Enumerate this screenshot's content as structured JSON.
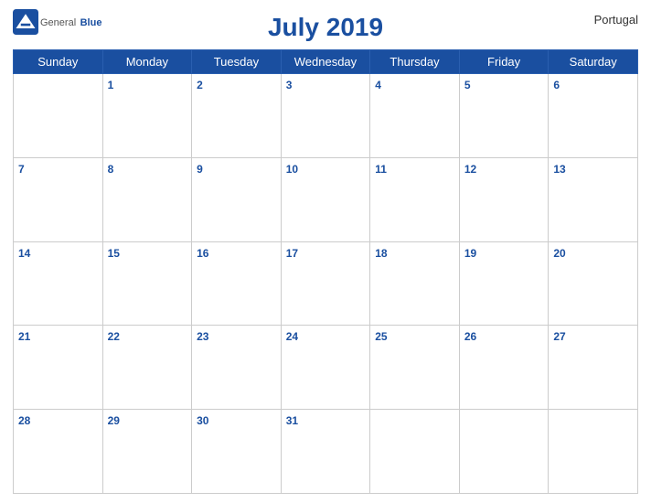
{
  "header": {
    "title": "July 2019",
    "country": "Portugal",
    "logo": {
      "general": "General",
      "blue": "Blue"
    }
  },
  "days_of_week": [
    "Sunday",
    "Monday",
    "Tuesday",
    "Wednesday",
    "Thursday",
    "Friday",
    "Saturday"
  ],
  "weeks": [
    [
      null,
      1,
      2,
      3,
      4,
      5,
      6
    ],
    [
      7,
      8,
      9,
      10,
      11,
      12,
      13
    ],
    [
      14,
      15,
      16,
      17,
      18,
      19,
      20
    ],
    [
      21,
      22,
      23,
      24,
      25,
      26,
      27
    ],
    [
      28,
      29,
      30,
      31,
      null,
      null,
      null
    ]
  ]
}
